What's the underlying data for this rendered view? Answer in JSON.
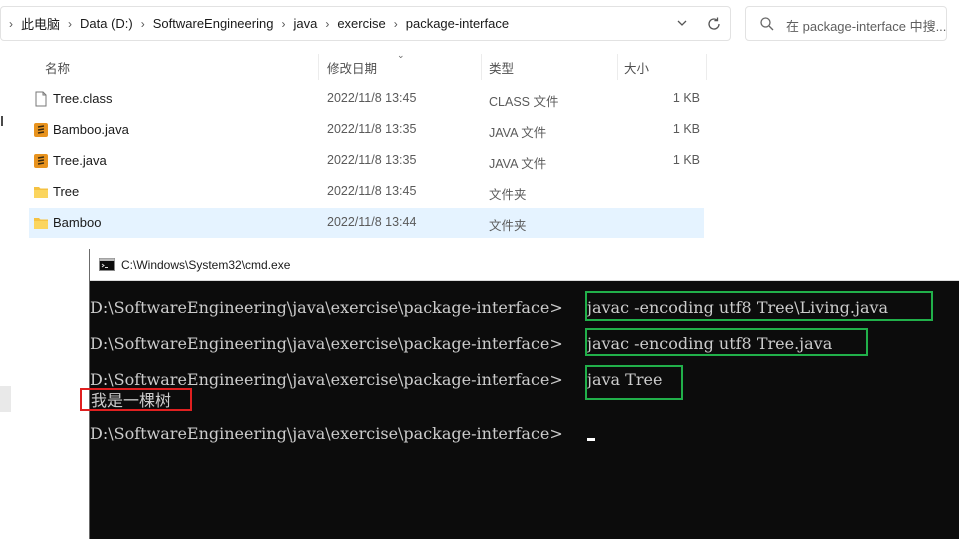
{
  "explorer": {
    "breadcrumbs": [
      "此电脑",
      "Data (D:)",
      "SoftwareEngineering",
      "java",
      "exercise",
      "package-interface"
    ],
    "search_placeholder": "在 package-interface 中搜...",
    "columns": {
      "name": "名称",
      "date": "修改日期",
      "type": "类型",
      "size": "大小"
    },
    "files": [
      {
        "name": "Tree.class",
        "date": "2022/11/8 13:45",
        "type": "CLASS 文件",
        "size": "1 KB",
        "icon": "class-file-icon"
      },
      {
        "name": "Bamboo.java",
        "date": "2022/11/8 13:35",
        "type": "JAVA 文件",
        "size": "1 KB",
        "icon": "java-file-icon"
      },
      {
        "name": "Tree.java",
        "date": "2022/11/8 13:35",
        "type": "JAVA 文件",
        "size": "1 KB",
        "icon": "java-file-icon"
      },
      {
        "name": "Tree",
        "date": "2022/11/8 13:45",
        "type": "文件夹",
        "size": "",
        "icon": "folder-icon"
      },
      {
        "name": "Bamboo",
        "date": "2022/11/8 13:44",
        "type": "文件夹",
        "size": "",
        "icon": "folder-icon",
        "selected": true
      }
    ],
    "colors": {
      "selected_row": "#e5f3ff",
      "folder": "#f5c242",
      "java_icon": "#e8931e"
    }
  },
  "cmd": {
    "title": "C:\\Windows\\System32\\cmd.exe",
    "prompt": "D:\\SoftwareEngineering\\java\\exercise\\package-interface>",
    "commands": [
      "javac -encoding utf8 Tree\\Living.java",
      "javac -encoding utf8 Tree.java",
      "java Tree"
    ],
    "output": "我是一棵树",
    "colors": {
      "background": "#0c0c0c",
      "text": "#cccccc",
      "highlight_green": "#21b04a",
      "highlight_red": "#e02020"
    }
  }
}
